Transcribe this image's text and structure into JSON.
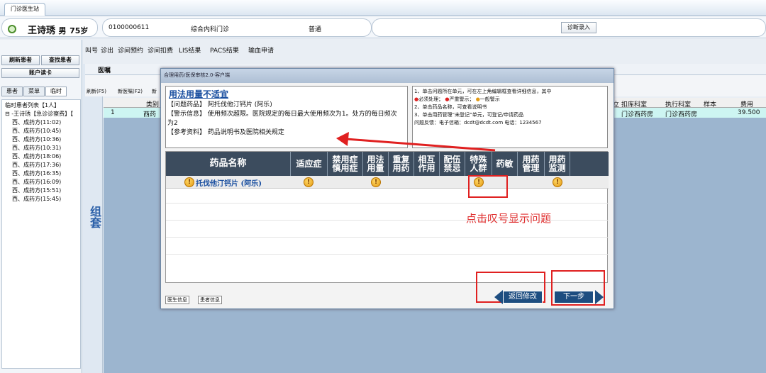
{
  "tab": {
    "label": "门诊医生站"
  },
  "patient": {
    "name": "王诗琇",
    "gender": "男",
    "age": "75岁",
    "id": "0100000611",
    "dept": "综合内科门诊",
    "level": "普通"
  },
  "diag_button": "诊断录入",
  "menu": [
    "叫号",
    "诊出",
    "诊间预约",
    "诊间扣费",
    "LIS结果",
    "PACS结果",
    "输血申请"
  ],
  "left_buttons": {
    "refresh": "刷新患者",
    "find": "查找患者",
    "card": "账户读卡"
  },
  "left_tabs": [
    "患者",
    "菜单",
    "临时"
  ],
  "tree": {
    "root": "临时患者列表【1人】",
    "patient": "王诗琇【急诊诊察费】【",
    "items": [
      "西、成药方(11:02)",
      "西、成药方(10:45)",
      "西、成药方(10:36)",
      "西、成药方(10:31)",
      "西、成药方(18:06)",
      "西、成药方(17:36)",
      "西、成药方(16:35)",
      "西、成药方(16:09)",
      "西、成药方(15:51)",
      "西、成药方(15:45)"
    ]
  },
  "vertical_label": "组套",
  "toolbar": {
    "panel": "医嘱",
    "refresh": "刷新(F5)",
    "new": "新医嘱(F2)",
    "new2": "新"
  },
  "grid": {
    "headers": [
      "类别",
      "立",
      "扣库科室",
      "执行科室",
      "样本",
      "费用"
    ],
    "row": {
      "num": "1",
      "type": "西药",
      "stock": "门诊西药房",
      "exec": "门诊西药房",
      "fee": "39.500"
    }
  },
  "dialog": {
    "title": "合理用药/医保审核2.0-客户端",
    "msg_title": "用法用量不适宜",
    "msg_lines": [
      "【问题药品】 阿托伐他汀钙片 (阿乐)",
      "【警示信息】 使用频次超限。医院规定的每日最大使用频次为1。处方的每日频次为2",
      "【参考资料】 药品说明书及医院相关规定"
    ],
    "notes": [
      "1、单击问题所在单元，可在左上角编辑框查看详细信息，其中",
      "必须处理；",
      "严重警示；",
      "一般警示",
      "2、单击药品名称，可查看说明书",
      "3、单击用药管理“未登记”单元，可登记/申请药品",
      "问题反馈：电子信箱：dcdt@dcdt.com 电话：1234567"
    ],
    "headers": [
      "药品名称",
      "适应症",
      "禁用症\n慎用症",
      "用法\n用量",
      "重复\n用药",
      "相互\n作用",
      "配伍\n禁忌",
      "特殊\n人群",
      "药敏",
      "用药\n管理",
      "用药\n监测"
    ],
    "drug": "托伐他汀钙片 (阿乐)",
    "annotation": "点击叹号显示问题",
    "back_button": "返回修改",
    "next_button": "下一步",
    "footer_tabs": [
      "医生信息",
      "患者信息"
    ]
  }
}
